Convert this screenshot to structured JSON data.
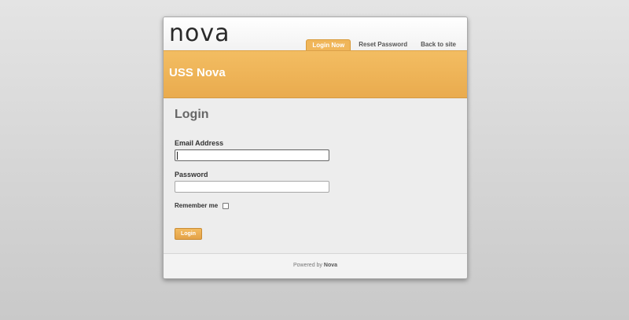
{
  "header": {
    "logo_text": "nova",
    "tabs": [
      {
        "label": "Login Now",
        "active": true
      },
      {
        "label": "Reset Password",
        "active": false
      },
      {
        "label": "Back to site",
        "active": false
      }
    ]
  },
  "banner": {
    "title": "USS Nova",
    "color": "#f0b55b"
  },
  "form": {
    "title": "Login",
    "email_label": "Email Address",
    "email_value": "",
    "password_label": "Password",
    "password_value": "",
    "remember_label": "Remember me",
    "remember_checked": false,
    "submit_label": "Login"
  },
  "footer": {
    "powered_prefix": "Powered by",
    "powered_name": "Nova"
  }
}
